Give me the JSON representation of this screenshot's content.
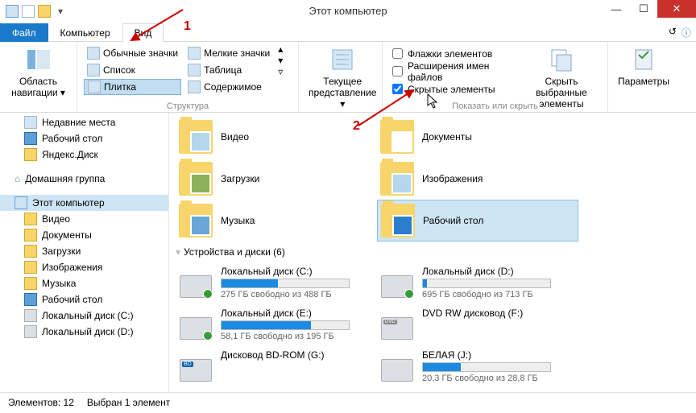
{
  "title": "Этот компьютер",
  "annotations": {
    "n1": "1",
    "n2": "2"
  },
  "tabs": {
    "file": "Файл",
    "computer": "Компьютер",
    "view": "Вид"
  },
  "ribbon": {
    "nav": {
      "nav_region": "Область навигации ▾",
      "group": ""
    },
    "layout": {
      "very_large": "Обычные значки",
      "small_icons": "Мелкие значки",
      "list": "Список",
      "table": "Таблица",
      "tiles": "Плитка",
      "content": "Содержимое",
      "group": "Структура"
    },
    "current_view": {
      "label": "Текущее представление ▾"
    },
    "show_hide": {
      "cb_flags": "Флажки элементов",
      "cb_ext": "Расширения имен файлов",
      "cb_hidden": "Скрытые элементы",
      "hide_sel": "Скрыть выбранные элементы",
      "group": "Показать или скрыть"
    },
    "options": "Параметры"
  },
  "nav": {
    "recent": "Недавние места",
    "desktop": "Рабочий стол",
    "yandex": "Яндекс.Диск",
    "homegroup": "Домашняя группа",
    "thispc": "Этот компьютер",
    "video": "Видео",
    "docs": "Документы",
    "downloads": "Загрузки",
    "pictures": "Изображения",
    "music": "Музыка",
    "desk2": "Рабочий стол",
    "cdrive": "Локальный диск (C:)",
    "ddrive": "Локальный диск (D:)"
  },
  "folders": [
    {
      "name": "Видео"
    },
    {
      "name": "Документы"
    },
    {
      "name": "Загрузки"
    },
    {
      "name": "Изображения"
    },
    {
      "name": "Музыка"
    },
    {
      "name": "Рабочий стол",
      "selected": true
    }
  ],
  "drives_header": "Устройства и диски (6)",
  "drives": [
    {
      "name": "Локальный диск (C:)",
      "free": "275 ГБ свободно из 488 ГБ",
      "fill": 44
    },
    {
      "name": "Локальный диск (D:)",
      "free": "695 ГБ свободно из 713 ГБ",
      "fill": 3
    },
    {
      "name": "Локальный диск (E:)",
      "free": "58,1 ГБ свободно из 195 ГБ",
      "fill": 70
    },
    {
      "name": "DVD RW дисковод (F:)",
      "free": "",
      "fill": -1,
      "dvd": true
    },
    {
      "name": "Дисковод BD-ROM (G:)",
      "free": "",
      "fill": -1,
      "bd": true
    },
    {
      "name": "БЕЛАЯ (J:)",
      "free": "20,3 ГБ свободно из 28,8 ГБ",
      "fill": 30
    }
  ],
  "status": {
    "count": "Элементов: 12",
    "sel": "Выбран 1 элемент"
  }
}
